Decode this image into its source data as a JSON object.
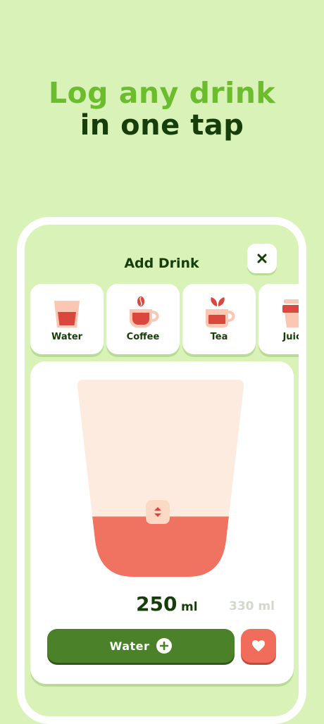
{
  "headline": {
    "line1": "Log any drink",
    "line2": "in one tap"
  },
  "modal": {
    "title": "Add Drink",
    "close_icon": "close-icon"
  },
  "drinks": [
    {
      "label": "Water",
      "icon": "water-glass-icon"
    },
    {
      "label": "Coffee",
      "icon": "coffee-cup-icon"
    },
    {
      "label": "Tea",
      "icon": "tea-cup-icon"
    },
    {
      "label": "Juice",
      "icon": "juice-cup-icon"
    }
  ],
  "amount": {
    "value": "250",
    "unit": "ml",
    "alternate": "330 ml",
    "fill_fraction": 0.32
  },
  "actions": {
    "log_label": "Water",
    "favorite_icon": "heart-icon"
  },
  "colors": {
    "background": "#d8f2b8",
    "headline_light": "#6cbd2e",
    "headline_dark": "#173d0b",
    "accent_red": "#ef6d5a",
    "button_green": "#4b8128",
    "cup_empty": "#fdebe0"
  }
}
